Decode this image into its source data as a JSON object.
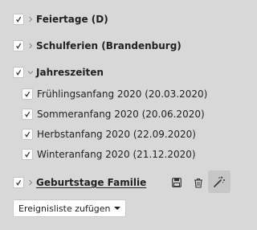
{
  "calendars": [
    {
      "label": "Feiertage (D)",
      "checked": true,
      "expanded": false
    },
    {
      "label": "Schulferien (Brandenburg)",
      "checked": true,
      "expanded": false
    },
    {
      "label": "Jahreszeiten",
      "checked": true,
      "expanded": true,
      "items": [
        {
          "label": "Frühlingsanfang 2020 (20.03.2020)",
          "checked": true
        },
        {
          "label": "Sommeranfang 2020 (20.06.2020)",
          "checked": true
        },
        {
          "label": "Herbstanfang 2020 (22.09.2020)",
          "checked": true
        },
        {
          "label": "Winteranfang 2020 (21.12.2020)",
          "checked": true
        }
      ]
    },
    {
      "label": "Geburtstage Familie",
      "checked": true,
      "expanded": false,
      "actions": [
        "save-icon",
        "trash-icon",
        "magic-wand-icon"
      ]
    }
  ],
  "footer": {
    "add_list_label": "Ereignisliste zufügen"
  },
  "colors": {
    "background": "#d8d8d8",
    "active_button": "#c6c6c6",
    "checkbox_fill": "#ffffff",
    "text": "#222222"
  }
}
